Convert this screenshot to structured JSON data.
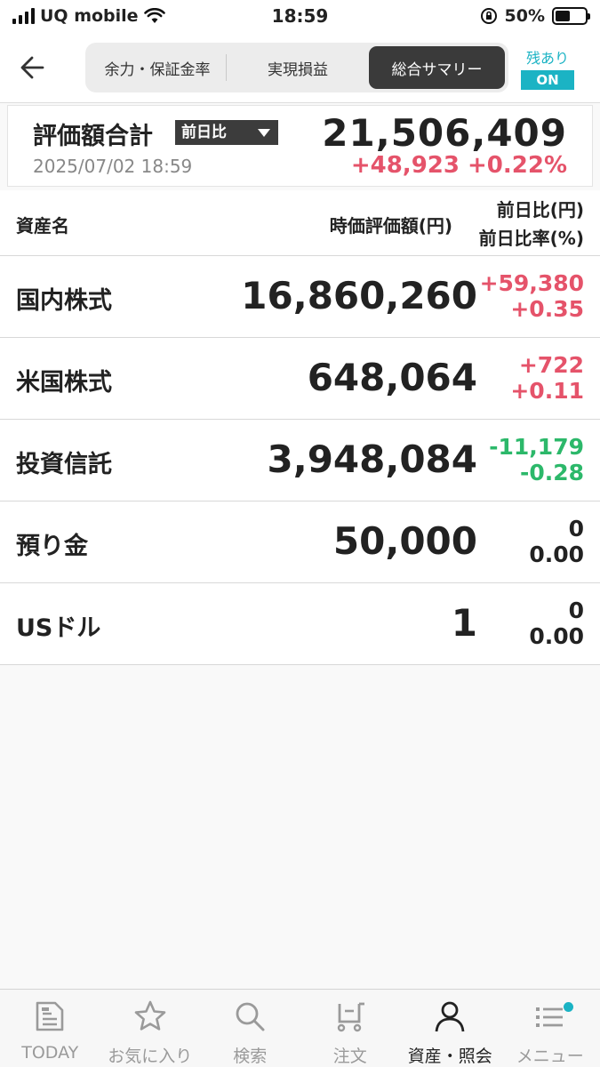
{
  "status_bar": {
    "carrier": "UQ mobile",
    "time": "18:59",
    "battery": "50%"
  },
  "header": {
    "segments": [
      "余力・保証金率",
      "実現損益",
      "総合サマリー"
    ],
    "zan_label": "残あり",
    "zan_toggle": "ON"
  },
  "summary": {
    "title": "評価額合計",
    "dropdown": "前日比",
    "date": "2025/07/02 18:59",
    "total": "21,506,409",
    "change": "+48,923 +0.22%"
  },
  "table": {
    "col_name": "資産名",
    "col_value": "時価評価額(円)",
    "col_change1": "前日比(円)",
    "col_change2": "前日比率(%)",
    "rows": [
      {
        "name": "国内株式",
        "value": "16,860,260",
        "change": "+59,380",
        "rate": "+0.35",
        "sign": "pos"
      },
      {
        "name": "米国株式",
        "value": "648,064",
        "change": "+722",
        "rate": "+0.11",
        "sign": "pos"
      },
      {
        "name": "投資信託",
        "value": "3,948,084",
        "change": "-11,179",
        "rate": "-0.28",
        "sign": "neg"
      },
      {
        "name": "預り金",
        "value": "50,000",
        "change": "0",
        "rate": "0.00",
        "sign": "zero"
      },
      {
        "name": "USドル",
        "value": "1",
        "change": "0",
        "rate": "0.00",
        "sign": "zero"
      }
    ]
  },
  "tabs": [
    {
      "label": "TODAY",
      "icon": "news-icon"
    },
    {
      "label": "お気に入り",
      "icon": "star-icon"
    },
    {
      "label": "検索",
      "icon": "search-icon"
    },
    {
      "label": "注文",
      "icon": "cart-icon"
    },
    {
      "label": "資産・照会",
      "icon": "person-icon",
      "active": true
    },
    {
      "label": "メニュー",
      "icon": "menu-icon"
    }
  ],
  "colors": {
    "accent": "#1bb3c4",
    "positive": "#e5536a",
    "negative": "#2cb86a"
  }
}
